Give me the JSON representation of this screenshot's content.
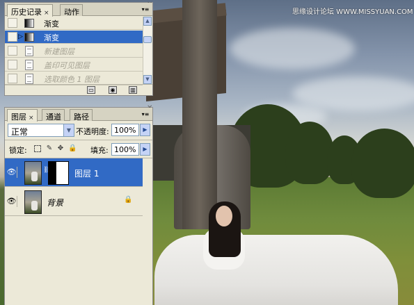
{
  "watermark": "思缘设计论坛 WWW.MISSYUAN.COM",
  "history_panel": {
    "tabs": [
      {
        "label": "历史记录",
        "close": "×"
      },
      {
        "label": "动作"
      }
    ],
    "menu_icon": "▾≡",
    "close_glyph": "✕",
    "items": [
      {
        "label": "渐变",
        "icon": "gradient-thumb",
        "selected": false,
        "ghost": false
      },
      {
        "label": "渐变",
        "icon": "gradient-thumb",
        "selected": true,
        "ghost": false,
        "marker": "▷"
      },
      {
        "label": "新建图层",
        "icon": "history-state-icon",
        "selected": false,
        "ghost": true
      },
      {
        "label": "盖印可见图层",
        "icon": "history-state-icon",
        "selected": false,
        "ghost": true
      },
      {
        "label": "选取颜色 1 图层",
        "icon": "history-state-icon",
        "selected": false,
        "ghost": true
      }
    ],
    "footer_icons": [
      "new-document-icon",
      "camera-icon",
      "trash-icon"
    ]
  },
  "layers_panel": {
    "tabs": [
      {
        "label": "图层",
        "close": "×"
      },
      {
        "label": "通道"
      },
      {
        "label": "路径"
      }
    ],
    "menu_icon": "▾≡",
    "close_glyph": "✕",
    "blend_mode": "正常",
    "opacity_label": "不透明度:",
    "opacity_value": "100%",
    "lock_label": "锁定:",
    "lock_icons": [
      "lock-transparent-icon",
      "lock-brush-icon",
      "lock-move-icon",
      "lock-all-icon"
    ],
    "fill_label": "填充:",
    "fill_value": "100%",
    "layers": [
      {
        "name": "图层 1",
        "visible": true,
        "selected": true,
        "has_mask": true
      },
      {
        "name": "背景",
        "visible": true,
        "selected": false,
        "locked": true
      }
    ]
  },
  "colors": {
    "selection": "#316ac5",
    "panel_bg": "#ece9d8",
    "accent_blue": "#c5d3f6"
  }
}
